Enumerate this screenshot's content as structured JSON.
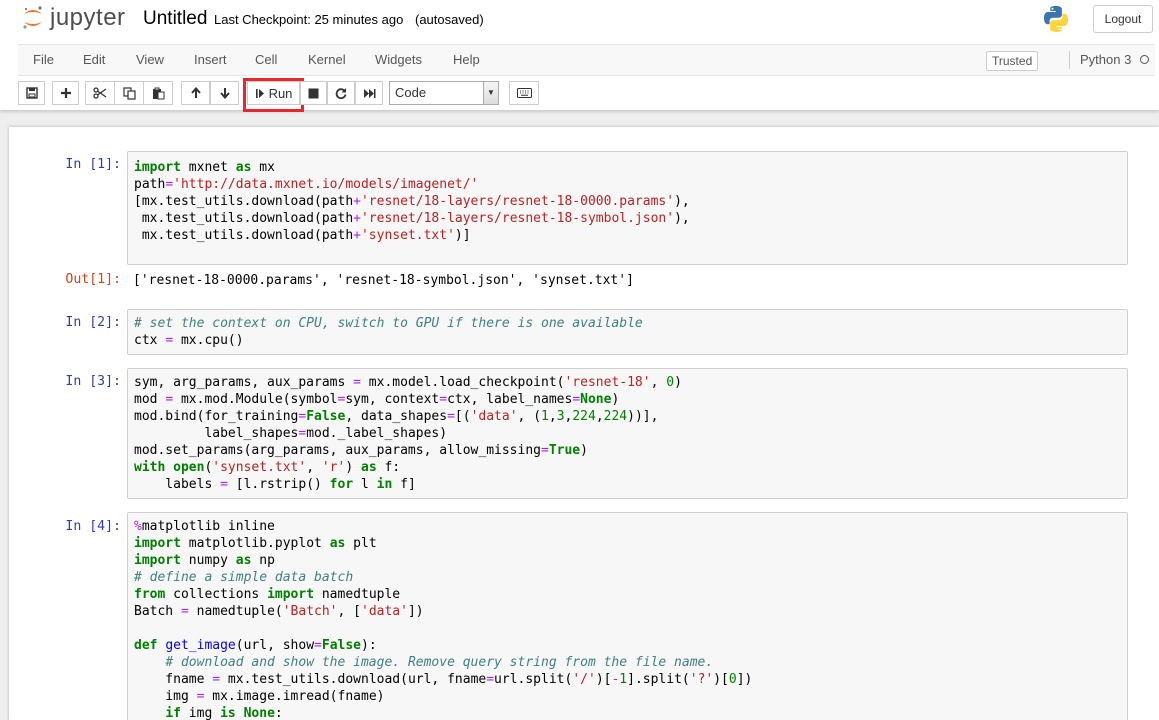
{
  "header": {
    "logo_text": "jupyter",
    "notebook_name": "Untitled",
    "checkpoint": "Last Checkpoint: 25 minutes ago",
    "autosave": "(autosaved)",
    "logout_label": "Logout"
  },
  "menu": {
    "items": [
      "File",
      "Edit",
      "View",
      "Insert",
      "Cell",
      "Kernel",
      "Widgets",
      "Help"
    ],
    "trusted_label": "Trusted",
    "kernel_name": "Python 3"
  },
  "toolbar": {
    "buttons": [
      "save-icon",
      "plus-icon",
      "cut-icon",
      "copy-icon",
      "paste-icon",
      "arrow-up-icon",
      "arrow-down-icon",
      "run",
      "stop-icon",
      "restart-icon",
      "fast-forward-icon",
      "keyboard-icon"
    ],
    "run_label": "Run",
    "cell_type": "Code",
    "highlight_color": "#e8262b"
  },
  "cells": [
    {
      "prompt": "In [1]:",
      "output_prompt": "Out[1]:",
      "output": "['resnet-18-0000.params', 'resnet-18-symbol.json', 'synset.txt']"
    },
    {
      "prompt": "In [2]:"
    },
    {
      "prompt": "In [3]:"
    },
    {
      "prompt": "In [4]:"
    }
  ],
  "colors": {
    "in_prompt": "#303f9f",
    "out_prompt": "#d84315",
    "keyword": "#008000",
    "string": "#ba2121",
    "comment": "#408080"
  }
}
